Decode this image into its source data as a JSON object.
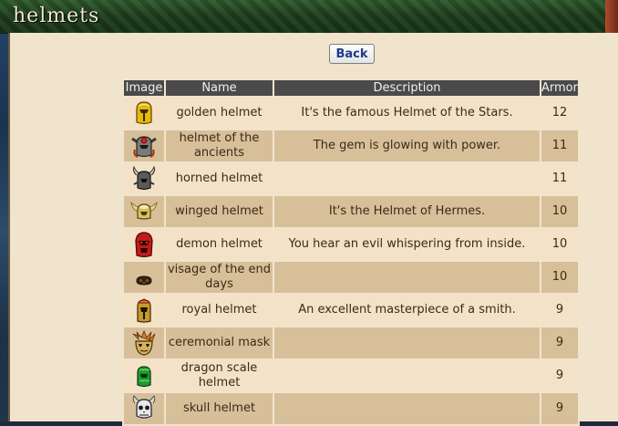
{
  "header": {
    "title": "helmets"
  },
  "back_button": {
    "label": "Back"
  },
  "table": {
    "columns": [
      "Image",
      "Name",
      "Description",
      "Armor"
    ],
    "rows": [
      {
        "icon": "golden-helmet-icon",
        "name": "golden helmet",
        "description": "It's the famous Helmet of the Stars.",
        "armor": "12"
      },
      {
        "icon": "helmet-of-the-ancients-icon",
        "name": "helmet of the ancients",
        "description": "The gem is glowing with power.",
        "armor": "11"
      },
      {
        "icon": "horned-helmet-icon",
        "name": "horned helmet",
        "description": "",
        "armor": "11"
      },
      {
        "icon": "winged-helmet-icon",
        "name": "winged helmet",
        "description": "It's the Helmet of Hermes.",
        "armor": "10"
      },
      {
        "icon": "demon-helmet-icon",
        "name": "demon helmet",
        "description": "You hear an evil whispering from inside.",
        "armor": "10"
      },
      {
        "icon": "visage-of-the-end-days-icon",
        "name": "visage of the end days",
        "description": "",
        "armor": "10"
      },
      {
        "icon": "royal-helmet-icon",
        "name": "royal helmet",
        "description": "An excellent masterpiece of a smith.",
        "armor": "9"
      },
      {
        "icon": "ceremonial-mask-icon",
        "name": "ceremonial mask",
        "description": "",
        "armor": "9"
      },
      {
        "icon": "dragon-scale-helmet-icon",
        "name": "dragon scale helmet",
        "description": "",
        "armor": "9"
      },
      {
        "icon": "skull-helmet-icon",
        "name": "skull helmet",
        "description": "",
        "armor": "9"
      }
    ]
  }
}
